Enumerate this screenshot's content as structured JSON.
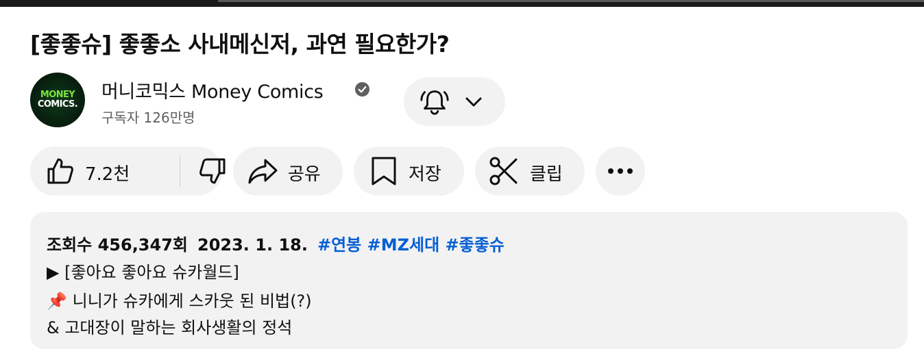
{
  "video": {
    "title": "[좋좋슈] 좋좋소 사내메신저, 과연 필요한가?"
  },
  "channel": {
    "name": "머니코믹스 Money Comics",
    "subscribers": "구독자 126만명",
    "logo_line1": "MONEY",
    "logo_line2": "COMICS."
  },
  "actions": {
    "like_count": "7.2천",
    "share_label": "공유",
    "save_label": "저장",
    "clip_label": "클립"
  },
  "description": {
    "views": "조회수 456,347회",
    "date": "2023. 1. 18.",
    "hashtags": [
      "#연봉",
      "#MZ세대",
      "#좋좋슈"
    ],
    "line2_marker": "▶",
    "line2": "[좋아요 좋아요 슈카월드]",
    "line3_emoji": "📌",
    "line3": "니니가 슈카에게 스카웃 된 비법(?)",
    "line4": "& 고대장이 말하는 회사생활의 정석"
  },
  "colors": {
    "pill_bg": "#f2f2f2",
    "hashtag": "#065fd4",
    "text": "#0f0f0f",
    "secondary_text": "#606060"
  },
  "icons": {
    "verified": "verified-check-icon",
    "bell": "bell-ringing-icon",
    "chevron": "chevron-down-icon",
    "like": "thumbs-up-icon",
    "dislike": "thumbs-down-icon",
    "share": "share-arrow-icon",
    "save": "bookmark-icon",
    "clip": "scissors-icon",
    "more": "more-horizontal-icon"
  }
}
